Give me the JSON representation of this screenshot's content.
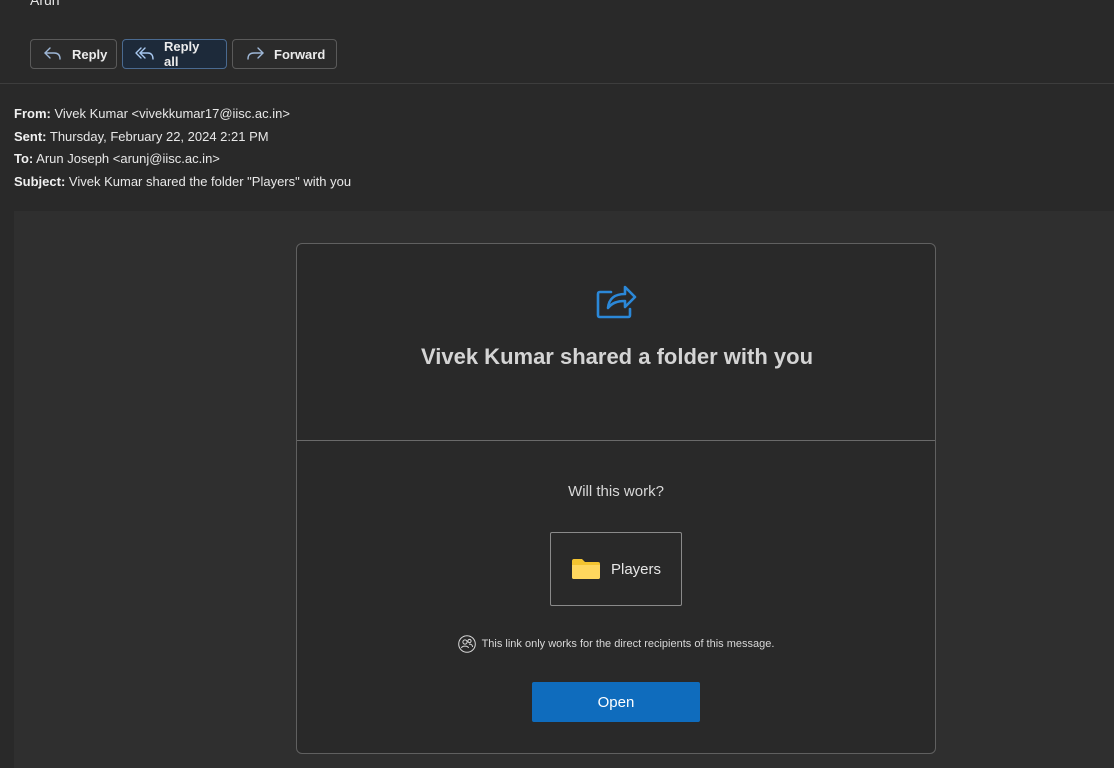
{
  "top": {
    "recipient_name": "Arun"
  },
  "actions": {
    "reply": "Reply",
    "reply_all": "Reply all",
    "forward": "Forward"
  },
  "headers": {
    "from_label": "From:",
    "from_value": "Vivek Kumar <vivekkumar17@iisc.ac.in>",
    "sent_label": "Sent:",
    "sent_value": "Thursday, February 22, 2024 2:21 PM",
    "to_label": "To:",
    "to_value": "Arun Joseph <arunj@iisc.ac.in>",
    "subject_label": "Subject:",
    "subject_value": "Vivek Kumar shared the folder \"Players\" with you"
  },
  "card": {
    "icon": "share-icon",
    "title": "Vivek Kumar shared a folder with you",
    "prompt": "Will this work?",
    "folder": {
      "icon": "folder-icon",
      "name": "Players"
    },
    "notice_icon": "people-icon",
    "notice": "This link only works for the direct recipients of this message.",
    "open_label": "Open"
  },
  "colors": {
    "background": "#292929",
    "accent": "#0f6cbd",
    "share_icon": "#2b88d8",
    "folder": "#f4c430"
  }
}
